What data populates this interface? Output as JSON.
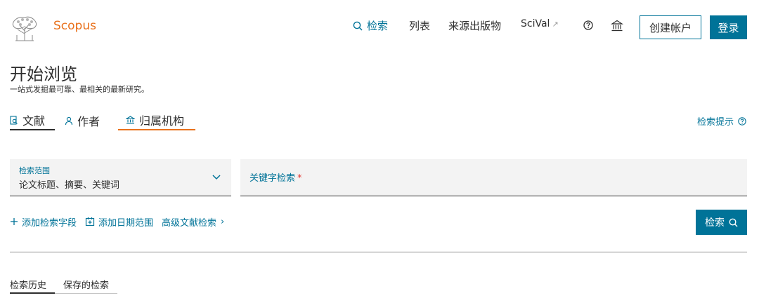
{
  "header": {
    "brand": "Scopus",
    "nav": {
      "search": "检索",
      "lists": "列表",
      "sources": "来源出版物",
      "scival": "SciVal",
      "scival_arrow": "↗"
    },
    "icons": [
      "search-icon",
      "help-icon",
      "institution-icon",
      "external-link-icon"
    ],
    "create_account": "创建帐户",
    "login": "登录"
  },
  "page": {
    "title": "开始浏览",
    "subtitle": "一站式发掘最可靠、最相关的最新研究。"
  },
  "tabs": [
    {
      "label": "文献",
      "icon": "document-icon",
      "active": false
    },
    {
      "label": "作者",
      "icon": "person-icon",
      "active": false
    },
    {
      "label": "归属机构",
      "icon": "institution-icon",
      "active": true
    }
  ],
  "search_tips": "检索提示",
  "search_form": {
    "scope_label": "检索范围",
    "scope_value": "论文标题、摘要、关键词",
    "keyword_label": "关键字检索",
    "required_mark": "*",
    "keyword_value": ""
  },
  "actions": {
    "add_field": "添加检索字段",
    "add_date": "添加日期范围",
    "advanced": "高级文献检索",
    "advanced_chevron": "›",
    "search_button": "检索"
  },
  "bottom_tabs": {
    "history": "检索历史",
    "saved": "保存的检索"
  },
  "colors": {
    "brand_orange": "#e9711c",
    "primary_blue": "#007398",
    "text": "#2e2e2e",
    "field_bg": "#f3f3f3",
    "required_red": "#e4352f"
  }
}
